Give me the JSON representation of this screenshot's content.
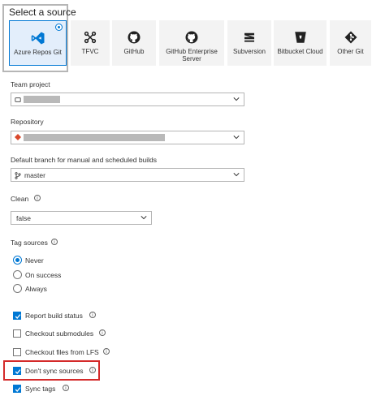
{
  "source_picker": {
    "title": "Select a source",
    "tiles": [
      {
        "label": "Azure Repos Git",
        "icon": "azure-repos-icon",
        "selected": true
      },
      {
        "label": "TFVC",
        "icon": "tfvc-icon",
        "selected": false
      },
      {
        "label": "GitHub",
        "icon": "github-icon",
        "selected": false
      },
      {
        "label": "GitHub Enterprise Server",
        "icon": "github-enterprise-icon",
        "selected": false
      },
      {
        "label": "Subversion",
        "icon": "subversion-icon",
        "selected": false
      },
      {
        "label": "Bitbucket Cloud",
        "icon": "bitbucket-icon",
        "selected": false
      },
      {
        "label": "Other Git",
        "icon": "git-icon",
        "selected": false
      }
    ]
  },
  "form": {
    "team_project": {
      "label": "Team project"
    },
    "repository": {
      "label": "Repository"
    },
    "default_branch": {
      "label": "Default branch for manual and scheduled builds",
      "value": "master"
    },
    "clean": {
      "label": "Clean",
      "value": "false"
    },
    "tag_sources": {
      "label": "Tag sources",
      "options": [
        {
          "label": "Never",
          "selected": true
        },
        {
          "label": "On success",
          "selected": false
        },
        {
          "label": "Always",
          "selected": false
        }
      ]
    },
    "checkboxes": [
      {
        "label": "Report build status",
        "checked": true
      },
      {
        "label": "Checkout submodules",
        "checked": false
      },
      {
        "label": "Checkout files from LFS",
        "checked": false
      },
      {
        "label": "Don't sync sources",
        "checked": true
      },
      {
        "label": "Sync tags",
        "checked": true
      }
    ]
  },
  "colors": {
    "accent": "#0078d4",
    "highlight": "#d42a2a",
    "tile_bg": "#f3f3f3"
  }
}
